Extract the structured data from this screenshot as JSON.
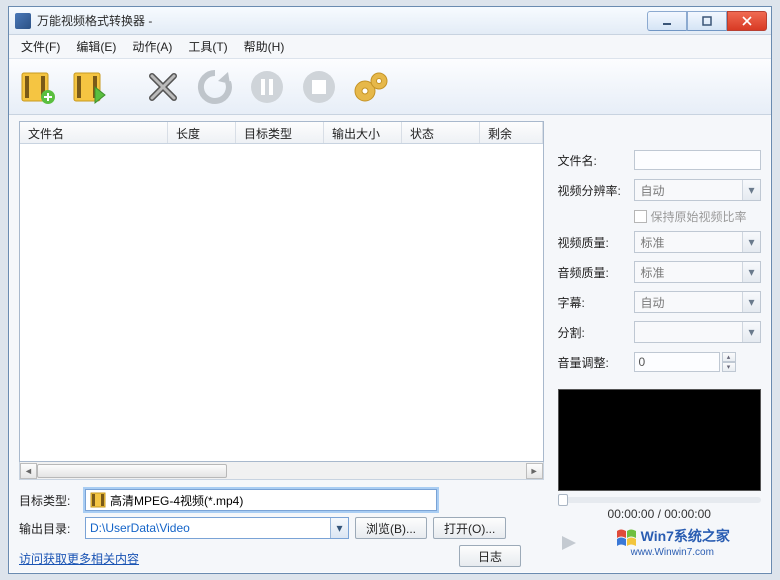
{
  "window": {
    "title": "万能视频格式转换器 - "
  },
  "menu": {
    "file": "文件(F)",
    "edit": "编辑(E)",
    "action": "动作(A)",
    "tools": "工具(T)",
    "help": "帮助(H)"
  },
  "list": {
    "columns": {
      "filename": "文件名",
      "length": "长度",
      "target_type": "目标类型",
      "output_size": "输出大小",
      "status": "状态",
      "remaining": "剩余"
    }
  },
  "bottom": {
    "target_type_label": "目标类型:",
    "target_type_value": "高清MPEG-4视频(*.mp4)",
    "output_dir_label": "输出目录:",
    "output_dir_value": "D:\\UserData\\Video",
    "browse_btn": "浏览(B)...",
    "open_btn": "打开(O)...",
    "log_btn": "日志",
    "more_link": "访问获取更多相关内容"
  },
  "props": {
    "filename_label": "文件名:",
    "filename_value": "",
    "resolution_label": "视频分辨率:",
    "resolution_value": "自动",
    "keep_ratio_label": "保持原始视频比率",
    "video_quality_label": "视频质量:",
    "video_quality_value": "标准",
    "audio_quality_label": "音频质量:",
    "audio_quality_value": "标准",
    "subtitle_label": "字幕:",
    "subtitle_value": "自动",
    "split_label": "分割:",
    "split_value": "",
    "volume_label": "音量调整:",
    "volume_value": "0"
  },
  "player": {
    "time": "00:00:00 / 00:00:00"
  },
  "branding": {
    "line1": "Win7系统之家",
    "line2": "www.Winwin7.com"
  }
}
